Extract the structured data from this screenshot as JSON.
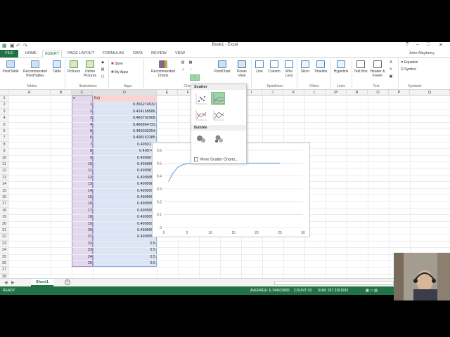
{
  "app": {
    "title": "Book1 - Excel",
    "user": "John Mayberry",
    "window_controls": [
      "?",
      "–",
      "□",
      "✕"
    ]
  },
  "tabs": [
    {
      "label": "FILE"
    },
    {
      "label": "HOME"
    },
    {
      "label": "INSERT",
      "active": true
    },
    {
      "label": "PAGE LAYOUT"
    },
    {
      "label": "FORMULAS"
    },
    {
      "label": "DATA"
    },
    {
      "label": "REVIEW"
    },
    {
      "label": "VIEW"
    }
  ],
  "ribbon": {
    "pivottable": "PivotTable",
    "recommended_pivottables": "Recommended PivotTables",
    "table": "Table",
    "pictures": "Pictures",
    "online_pictures": "Online Pictures",
    "store": "Store",
    "my_apps": "My Apps",
    "recommended_charts": "Recommended Charts",
    "pivotchart": "PivotChart",
    "power_view": "Power View",
    "line": "Line",
    "column": "Column",
    "win_loss": "Win/ Loss",
    "slicer": "Slicer",
    "timeline": "Timeline",
    "hyperlink": "Hyperlink",
    "text_box": "Text Box",
    "header_footer": "Header & Footer",
    "equation": "Equation",
    "symbol": "Symbol",
    "groups": {
      "tables": "Tables",
      "illustrations": "Illustrations",
      "apps": "Apps",
      "charts": "Cha",
      "sparklines": "Sparklines",
      "filters": "Filters",
      "links": "Links",
      "text": "Text",
      "symbols": "Symbols"
    }
  },
  "columns": [
    "A",
    "B",
    "C",
    "D",
    "E",
    "F",
    "G",
    "H",
    "I",
    "J",
    "K",
    "L",
    "M",
    "N",
    "O",
    "P",
    "Q"
  ],
  "rows": [
    "1",
    "2",
    "3",
    "4",
    "5",
    "6",
    "7",
    "8",
    "9",
    "10",
    "11",
    "12",
    "13",
    "14",
    "15",
    "16",
    "17",
    "18",
    "19",
    "20",
    "21",
    "22",
    "23",
    "24",
    "25",
    "26",
    "27",
    "28",
    "29"
  ],
  "sheet": {
    "header_x": "x",
    "header_fx": "f(x)",
    "x_values": [
      "1",
      "2",
      "3",
      "4",
      "5",
      "6",
      "7",
      "8",
      "9",
      "10",
      "11",
      "12",
      "13",
      "14",
      "15",
      "16",
      "17",
      "18",
      "19",
      "20",
      "21",
      "22",
      "23",
      "24",
      "25"
    ],
    "fx_values": [
      "0.356274532",
      "0.424158586",
      "0.466792908",
      "0.486864723",
      "0.495030254",
      "0.498152385",
      "0.4993178",
      "0.499748",
      "0.4999074",
      "0.4999659",
      "0.4999874",
      "0.4999953",
      "0.4999983",
      "0.4999994",
      "0.4999997",
      "0.4999999",
      "0.4999999",
      "0.4999999",
      "0.4999999",
      "0.4999999",
      "0.4999999",
      "0.5",
      "0.5",
      "0.5",
      "0.5"
    ]
  },
  "chart_data": {
    "type": "scatter",
    "title": "",
    "xlabel": "",
    "ylabel": "",
    "xlim": [
      0,
      30
    ],
    "ylim": [
      0,
      0.6
    ],
    "x_ticks": [
      "0",
      "5",
      "10",
      "15",
      "20",
      "25",
      "30"
    ],
    "y_ticks": [
      "0",
      "0.1",
      "0.2",
      "0.3",
      "0.4",
      "0.5",
      "0.6"
    ],
    "grid": true,
    "series": [
      {
        "x": [
          1,
          2,
          3,
          4,
          5,
          6,
          7,
          8,
          9,
          10,
          11,
          12,
          13,
          14,
          15,
          16,
          17,
          18,
          19,
          20,
          21,
          22,
          23,
          24,
          25
        ],
        "y": [
          0.3563,
          0.4242,
          0.4668,
          0.4869,
          0.495,
          0.4982,
          0.4993,
          0.4997,
          0.4999,
          0.5,
          0.5,
          0.5,
          0.5,
          0.5,
          0.5,
          0.5,
          0.5,
          0.5,
          0.5,
          0.5,
          0.5,
          0.5,
          0.5,
          0.5,
          0.5
        ],
        "color": "#5b9bd5"
      }
    ]
  },
  "dropdown": {
    "scatter_label": "Scatter",
    "bubble_label": "Bubble",
    "more_label": "More Scatter Charts..."
  },
  "sheet_tabs": {
    "active": "Sheet1"
  },
  "status": {
    "ready": "READY",
    "average": "AVERAGE: 6.744523865",
    "count": "COUNT: 52",
    "sum": "SUM: 337.2261933"
  },
  "colors": {
    "excel_green": "#217346",
    "series": "#5b9bd5",
    "hover": "#9fd5a6"
  }
}
